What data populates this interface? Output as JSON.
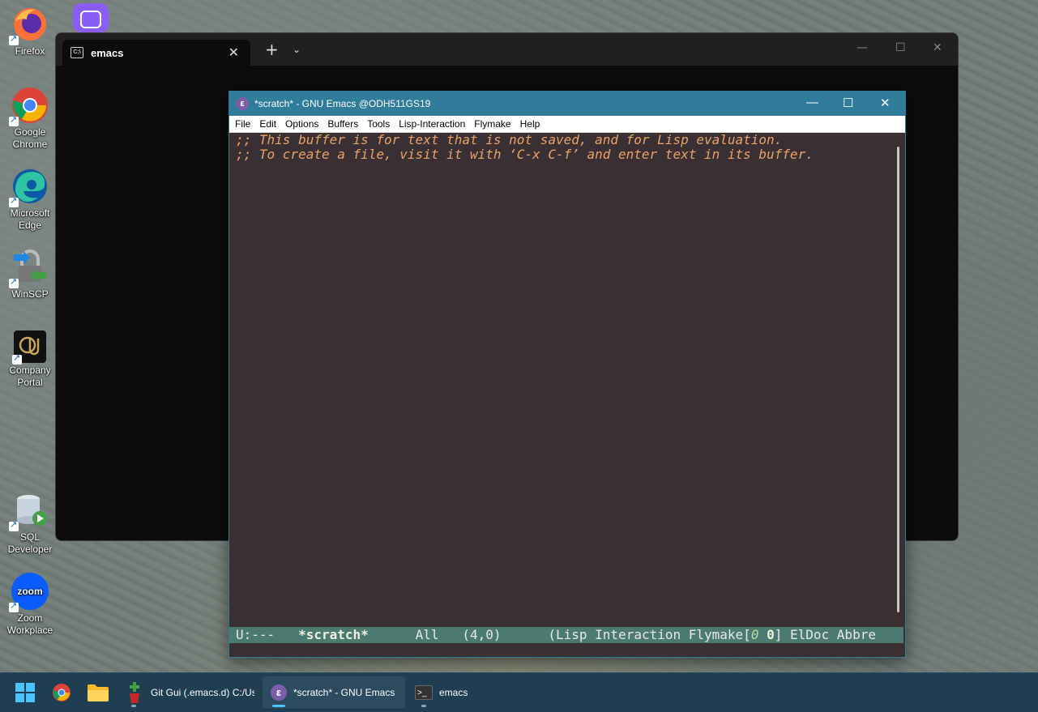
{
  "desktop": {
    "icons": [
      {
        "name": "firefox",
        "label": "Firefox"
      },
      {
        "name": "google-chrome",
        "label": "Google Chrome"
      },
      {
        "name": "microsoft-edge",
        "label": "Microsoft Edge"
      },
      {
        "name": "winscp",
        "label": "WinSCP"
      },
      {
        "name": "company-portal",
        "label": "Company Portal"
      },
      {
        "name": "sql-developer",
        "label": "SQL Developer"
      },
      {
        "name": "zoom-workplace",
        "label": "Zoom Workplace"
      }
    ]
  },
  "terminal": {
    "tab_title": "emacs",
    "tab_icon": "terminal-icon",
    "new_tab": "+",
    "dropdown": "⌄",
    "minimize": "—",
    "maximize": "☐",
    "close": "✕"
  },
  "emacs": {
    "title": "*scratch*  -  GNU Emacs @ODH511GS19",
    "minimize": "—",
    "maximize": "☐",
    "close": "✕",
    "menu": [
      "File",
      "Edit",
      "Options",
      "Buffers",
      "Tools",
      "Lisp-Interaction",
      "Flymake",
      "Help"
    ],
    "buffer_lines": [
      ";; This buffer is for text that is not saved, and for Lisp evaluation.",
      ";; To create a file, visit it with ‘C-x C-f’ and enter text in its buffer."
    ],
    "modeline": {
      "status": "U:---",
      "buffer_name": "*scratch*",
      "position": "All",
      "line_col": "(4,0)",
      "modes_prefix": "(Lisp Interaction Flymake[",
      "errors": "0",
      "warnings": "0",
      "modes_suffix": "] ElDoc Abbre"
    },
    "colors": {
      "background": "#3a3034",
      "comment": "#e9a264",
      "modeline": "#4d7a6e",
      "titlebar": "#2f7d9b"
    }
  },
  "taskbar": {
    "tasks": [
      {
        "name": "git-gui",
        "label": "Git Gui (.emacs.d) C:/Use"
      },
      {
        "name": "emacs",
        "label": "*scratch*  -  GNU Emacs"
      },
      {
        "name": "terminal",
        "label": "emacs"
      }
    ]
  }
}
